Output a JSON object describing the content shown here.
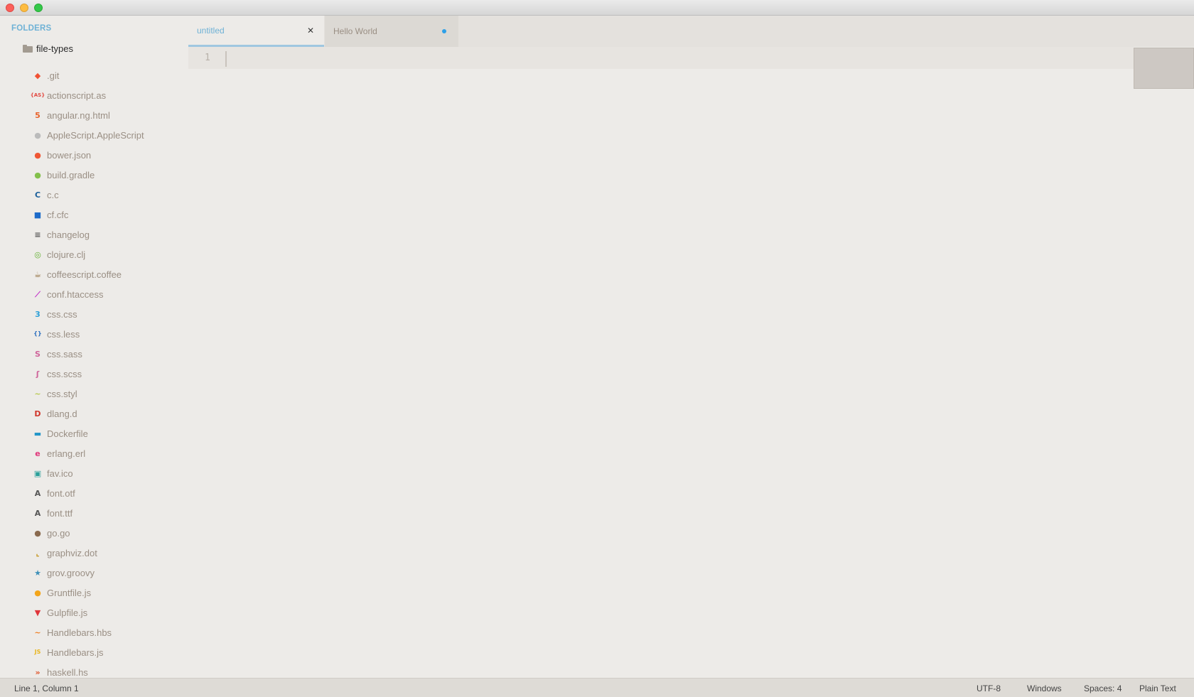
{
  "sidebar": {
    "header": "FOLDERS",
    "root_folder": "file-types",
    "files": [
      {
        "label": ".git",
        "icon": "git-icon",
        "glyph": "◆",
        "color": "#f05133"
      },
      {
        "label": "actionscript.as",
        "icon": "actionscript-icon",
        "glyph": "{AS}",
        "color": "#e2473f"
      },
      {
        "label": "angular.ng.html",
        "icon": "html5-icon",
        "glyph": "5",
        "color": "#e8622b"
      },
      {
        "label": "AppleScript.AppleScript",
        "icon": "apple-icon",
        "glyph": "●",
        "color": "#bbbbbb"
      },
      {
        "label": "bower.json",
        "icon": "bower-icon",
        "glyph": "●",
        "color": "#ef5734"
      },
      {
        "label": "build.gradle",
        "icon": "gradle-icon",
        "glyph": "●",
        "color": "#83c04b"
      },
      {
        "label": "c.c",
        "icon": "c-icon",
        "glyph": "C",
        "color": "#1b5f9a"
      },
      {
        "label": "cf.cfc",
        "icon": "coldfusion-icon",
        "glyph": "■",
        "color": "#1d6bc9"
      },
      {
        "label": "changelog",
        "icon": "changelog-icon",
        "glyph": "≡",
        "color": "#555555"
      },
      {
        "label": "clojure.clj",
        "icon": "clojure-icon",
        "glyph": "◎",
        "color": "#63b132"
      },
      {
        "label": "coffeescript.coffee",
        "icon": "coffee-icon",
        "glyph": "☕",
        "color": "#8f6b3a"
      },
      {
        "label": "conf.htaccess",
        "icon": "apache-feather-icon",
        "glyph": "⟋",
        "color": "#c02ec7"
      },
      {
        "label": "css.css",
        "icon": "css3-icon",
        "glyph": "3",
        "color": "#2da0d7"
      },
      {
        "label": "css.less",
        "icon": "less-icon",
        "glyph": "{}",
        "color": "#2a6ebe"
      },
      {
        "label": "css.sass",
        "icon": "sass-icon",
        "glyph": "S",
        "color": "#cf649a"
      },
      {
        "label": "css.scss",
        "icon": "scss-icon",
        "glyph": "ʃ",
        "color": "#cf649a"
      },
      {
        "label": "css.styl",
        "icon": "stylus-icon",
        "glyph": "~",
        "color": "#b7c94b"
      },
      {
        "label": "dlang.d",
        "icon": "dlang-icon",
        "glyph": "D",
        "color": "#d0372c"
      },
      {
        "label": "Dockerfile",
        "icon": "docker-icon",
        "glyph": "▬",
        "color": "#2496c8"
      },
      {
        "label": "erlang.erl",
        "icon": "erlang-icon",
        "glyph": "e",
        "color": "#e0357a"
      },
      {
        "label": "fav.ico",
        "icon": "image-icon",
        "glyph": "▣",
        "color": "#2aa09a"
      },
      {
        "label": "font.otf",
        "icon": "font-icon",
        "glyph": "A",
        "color": "#555555"
      },
      {
        "label": "font.ttf",
        "icon": "font-icon",
        "glyph": "A",
        "color": "#555555"
      },
      {
        "label": "go.go",
        "icon": "gopher-icon",
        "glyph": "●",
        "color": "#8a6a4e"
      },
      {
        "label": "graphviz.dot",
        "icon": "graphviz-icon",
        "glyph": "⌞",
        "color": "#c79a28"
      },
      {
        "label": "grov.groovy",
        "icon": "groovy-star-icon",
        "glyph": "★",
        "color": "#3e90b8"
      },
      {
        "label": "Gruntfile.js",
        "icon": "grunt-icon",
        "glyph": "●",
        "color": "#f3a51a"
      },
      {
        "label": "Gulpfile.js",
        "icon": "gulp-icon",
        "glyph": "▼",
        "color": "#e0353a"
      },
      {
        "label": "Handlebars.hbs",
        "icon": "handlebars-mustache-icon",
        "glyph": "~",
        "color": "#f08025"
      },
      {
        "label": "Handlebars.js",
        "icon": "js-icon",
        "glyph": "JS",
        "color": "#e8b520"
      },
      {
        "label": "haskell.hs",
        "icon": "haskell-icon",
        "glyph": "»",
        "color": "#e0552b"
      }
    ]
  },
  "tabs": [
    {
      "label": "untitled",
      "active": true
    },
    {
      "label": "Hello World",
      "active": false,
      "dirty": true
    }
  ],
  "editor": {
    "line_number": "1"
  },
  "status": {
    "position": "Line 1, Column 1",
    "encoding": "UTF-8",
    "line_endings": "Windows",
    "indentation": "Spaces: 4",
    "syntax": "Plain Text"
  },
  "colors": {
    "accent": "#6fb2d6",
    "dirty_dot": "#2ea0e8",
    "background": "#edebe8"
  }
}
